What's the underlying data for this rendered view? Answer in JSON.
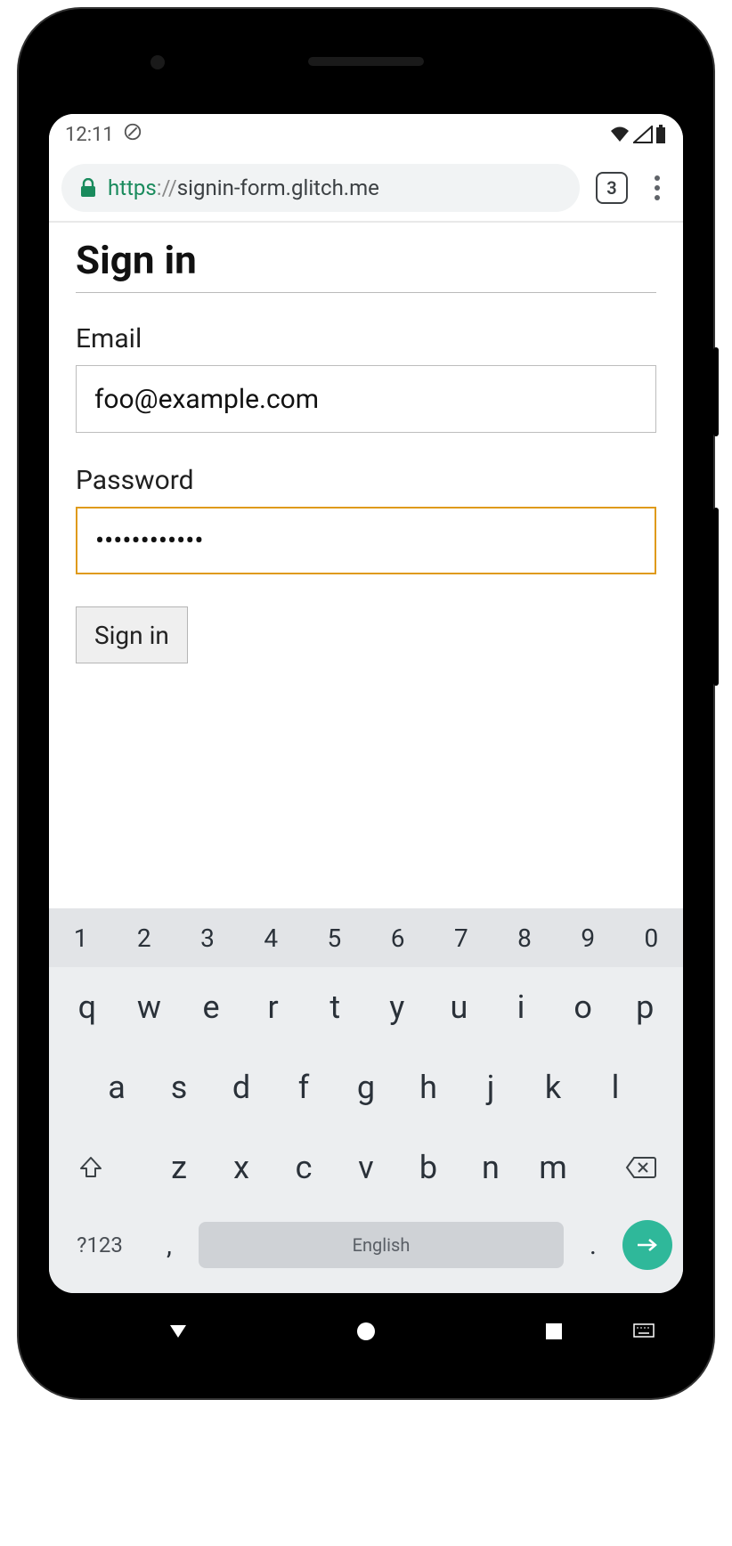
{
  "status": {
    "time": "12:11",
    "tab_count": "3"
  },
  "url": {
    "scheme": "https",
    "sep": "://",
    "host": "signin-form.glitch.me"
  },
  "form": {
    "title": "Sign in",
    "email_label": "Email",
    "email_value": "foo@example.com",
    "password_label": "Password",
    "password_value": "••••••••••••",
    "submit_label": "Sign in"
  },
  "keyboard": {
    "numbers": [
      "1",
      "2",
      "3",
      "4",
      "5",
      "6",
      "7",
      "8",
      "9",
      "0"
    ],
    "row1": [
      "q",
      "w",
      "e",
      "r",
      "t",
      "y",
      "u",
      "i",
      "o",
      "p"
    ],
    "row2": [
      "a",
      "s",
      "d",
      "f",
      "g",
      "h",
      "j",
      "k",
      "l"
    ],
    "row3": [
      "z",
      "x",
      "c",
      "v",
      "b",
      "n",
      "m"
    ],
    "symbol_key": "?123",
    "comma": ",",
    "period": ".",
    "space_label": "English"
  }
}
